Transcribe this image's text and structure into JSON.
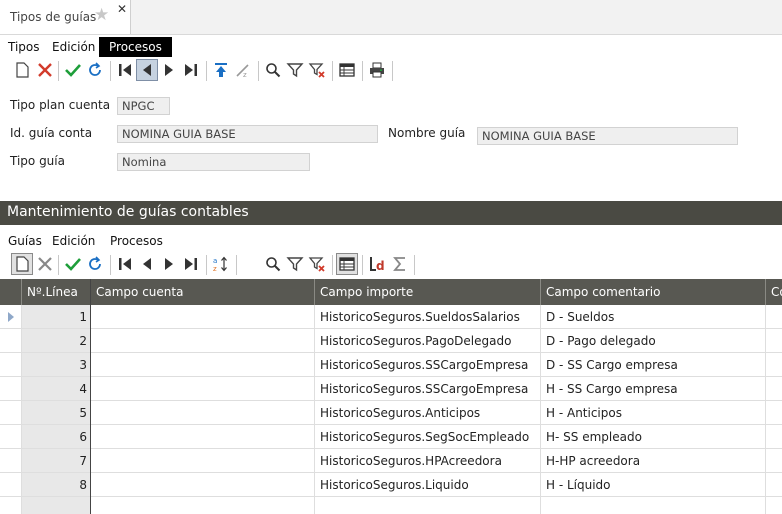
{
  "tab": {
    "title": "Tipos de guías"
  },
  "top_menu": {
    "items": [
      "Tipos",
      "Edición",
      "Procesos"
    ],
    "active": "Procesos"
  },
  "form": {
    "tipo_plan_cuenta_label": "Tipo plan cuenta",
    "tipo_plan_cuenta_value": "NPGC",
    "id_guia_label": "Id. guía conta",
    "id_guia_value": "NOMINA GUIA BASE",
    "nombre_guia_label": "Nombre guía",
    "nombre_guia_value": "NOMINA GUIA BASE",
    "tipo_guia_label": "Tipo guía",
    "tipo_guia_value": "Nomina"
  },
  "section": {
    "title": "Mantenimiento de guías contables"
  },
  "sub_menu": {
    "items": [
      "Guías",
      "Edición",
      "Procesos"
    ]
  },
  "grid": {
    "columns": [
      "Nº.Línea",
      "Campo cuenta",
      "Campo importe",
      "Campo comentario",
      "Có"
    ],
    "rows": [
      {
        "linea": "1",
        "cuenta": "",
        "importe": "HistoricoSeguros.SueldosSalarios",
        "comentario": "D - Sueldos"
      },
      {
        "linea": "2",
        "cuenta": "",
        "importe": "HistoricoSeguros.PagoDelegado",
        "comentario": "D - Pago delegado"
      },
      {
        "linea": "3",
        "cuenta": "",
        "importe": "HistoricoSeguros.SSCargoEmpresa",
        "comentario": "D - SS Cargo empresa"
      },
      {
        "linea": "4",
        "cuenta": "",
        "importe": "HistoricoSeguros.SSCargoEmpresa",
        "comentario": "H - SS Cargo empresa"
      },
      {
        "linea": "5",
        "cuenta": "",
        "importe": "HistoricoSeguros.Anticipos",
        "comentario": "H - Anticipos"
      },
      {
        "linea": "6",
        "cuenta": "",
        "importe": "HistoricoSeguros.SegSocEmpleado",
        "comentario": "H- SS empleado"
      },
      {
        "linea": "7",
        "cuenta": "",
        "importe": "HistoricoSeguros.HPAcreedora",
        "comentario": "H-HP acreedora"
      },
      {
        "linea": "8",
        "cuenta": "",
        "importe": "HistoricoSeguros.Liquido",
        "comentario": "H - Líquido"
      }
    ]
  },
  "icons": {
    "toolbar_top": [
      "new-icon",
      "delete-icon",
      "accept-icon",
      "refresh-icon",
      "first-icon",
      "previous-icon",
      "next-icon",
      "last-icon",
      "import-icon",
      "sort-icon",
      "search-icon",
      "filter-icon",
      "clear-filter-icon",
      "grid-view-icon",
      "print-icon"
    ],
    "toolbar_grid": [
      "new-icon",
      "delete-icon",
      "accept-icon",
      "refresh-icon",
      "first-icon",
      "previous-icon",
      "next-icon",
      "last-icon",
      "sort-az-icon",
      "search-icon",
      "filter-icon",
      "clear-filter-icon",
      "grid-view-icon",
      "ld-icon",
      "sum-icon"
    ]
  },
  "colors": {
    "accept": "#1e9e3a",
    "delete": "#d23b2b",
    "section_band": "#4a4a43",
    "grid_header": "#585852"
  }
}
